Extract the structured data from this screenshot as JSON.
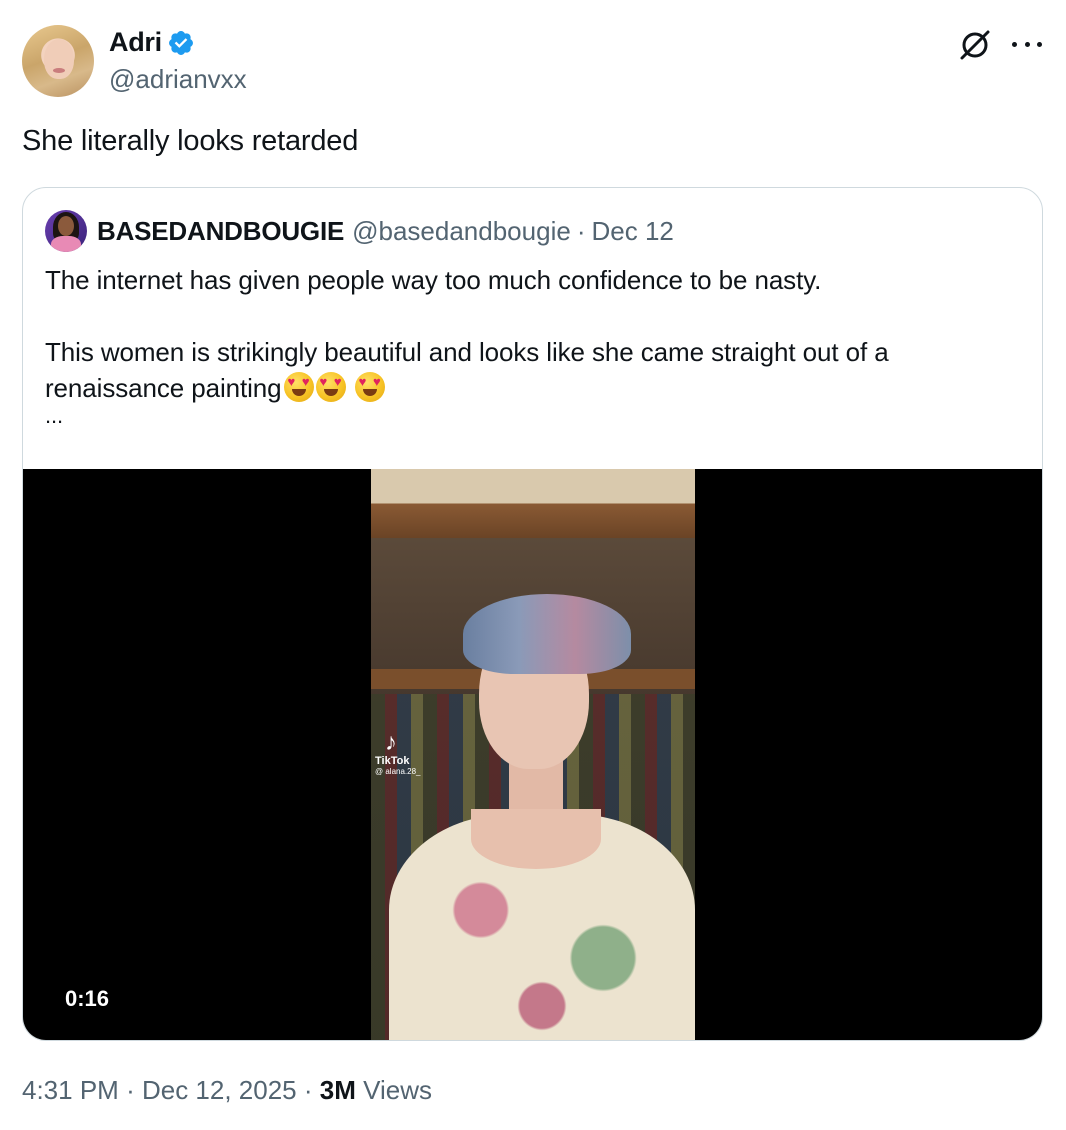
{
  "author": {
    "display_name": "Adri",
    "handle": "@adrianvxx",
    "verified": true
  },
  "tweet": {
    "text": "She literally looks retarded"
  },
  "quoted_tweet": {
    "display_name": "BASEDANDBOUGIE",
    "handle": "@basedandbougie",
    "separator": "·",
    "date": "Dec 12",
    "line1": "The internet has given people way too much confidence to be nasty.",
    "line2": "This women is strikingly beautiful and looks like she came straight out of a renaissance painting",
    "emojis": [
      "heart-eyes-emoji",
      "heart-eyes-emoji",
      "heart-eyes-emoji"
    ],
    "truncation": "...",
    "video": {
      "duration": "0:16",
      "watermark_brand": "TikTok",
      "watermark_user": "@ alana.28_"
    }
  },
  "meta": {
    "time": "4:31 PM",
    "separator": "·",
    "date": "Dec 12, 2025",
    "views_count": "3M",
    "views_label": "Views"
  },
  "colors": {
    "text": "#0f1419",
    "secondary": "#536471",
    "verified": "#1d9bf0",
    "border": "#cfd9de"
  }
}
